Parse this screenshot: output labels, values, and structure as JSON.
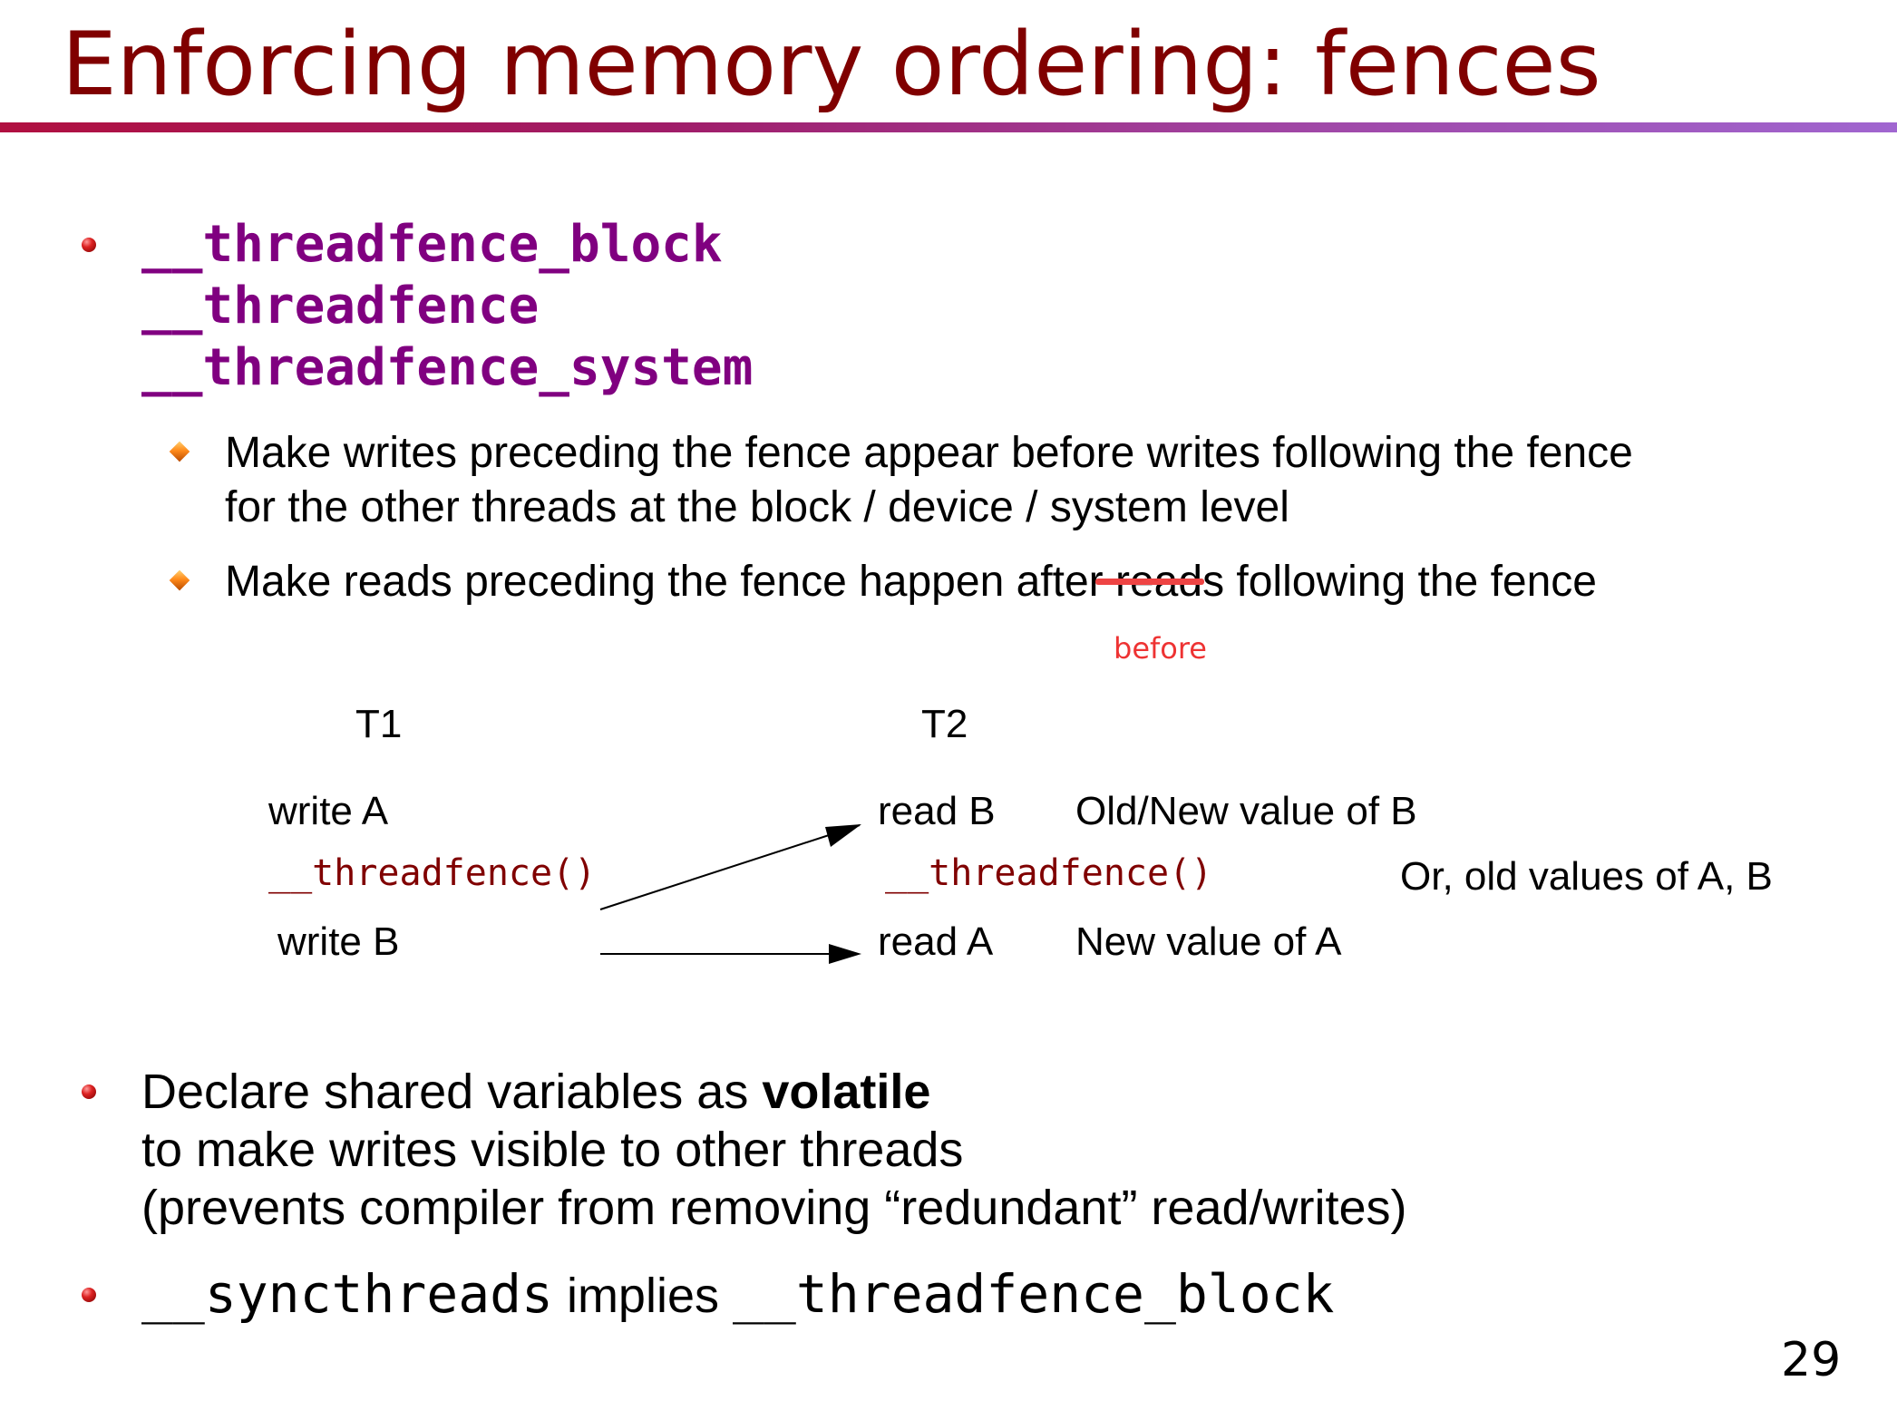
{
  "slide": {
    "title": "Enforcing memory ordering: fences",
    "page_number": "29"
  },
  "fences": {
    "functions": [
      "__threadfence_block",
      "__threadfence",
      "__threadfence_system"
    ],
    "points": [
      {
        "line1": "Make writes preceding the fence appear before writes following the fence",
        "line2": "for the other threads at the block / device / system level"
      },
      {
        "text_before": "Make reads preceding the fence happen ",
        "struck_word": "after",
        "text_after": " reads following the fence",
        "correction": "before"
      }
    ]
  },
  "diagram": {
    "t1_header": "T1",
    "t2_header": "T2",
    "t1_ops": [
      "write A",
      "__threadfence()",
      "write B"
    ],
    "t2_ops": [
      "read B",
      "__threadfence()",
      "read A"
    ],
    "outcomes": [
      "Old/New value of B",
      "New value of A"
    ],
    "alternative": "Or, old values of A, B"
  },
  "volatile": {
    "line1_prefix": "Declare shared variables as ",
    "keyword": "volatile",
    "line2": "to make writes visible to other threads",
    "line3": "(prevents compiler from removing “redundant” read/writes)"
  },
  "syncthreads": {
    "code1": "__syncthreads",
    "middle": " implies ",
    "code2": "__threadfence_block"
  }
}
